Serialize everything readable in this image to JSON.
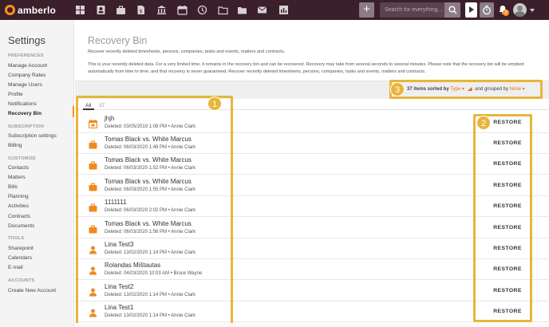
{
  "app": {
    "name": "amberlo",
    "accent": "#f7931e",
    "callout_color": "#e8b53a"
  },
  "topbar": {
    "nav_icons": [
      "dashboard-icon",
      "contacts-icon",
      "matters-icon",
      "bills-icon",
      "bank-icon",
      "calendar-icon",
      "history-icon",
      "folder-icon",
      "documents-icon",
      "mail-icon",
      "reports-icon"
    ],
    "add_label": "+",
    "search_placeholder": "Search for everything...",
    "notification_count": "2"
  },
  "sidebar": {
    "title": "Settings",
    "sections": [
      {
        "label": "PREFERENCES",
        "items": [
          "Manage Account",
          "Company Rates",
          "Manage Users",
          "Profile",
          "Notifications",
          "Recovery Bin"
        ]
      },
      {
        "label": "SUBSCRIPTION",
        "items": [
          "Subscription settings",
          "Billing"
        ]
      },
      {
        "label": "CUSTOMIZE",
        "items": [
          "Contacts",
          "Matters",
          "Bills",
          "Planning",
          "Activities",
          "Contracts",
          "Documents"
        ]
      },
      {
        "label": "TOOLS",
        "items": [
          "Sharepoint",
          "Calendars",
          "E-mail"
        ]
      },
      {
        "label": "ACCOUNTS",
        "items": [
          "Create New Account"
        ]
      }
    ],
    "active_item": "Recovery Bin"
  },
  "header": {
    "title": "Recovery Bin",
    "subtitle": "Recover recently deleted timesheets, persons, companies, tasks and events, matters and contracts.",
    "description": "This is your recently deleted data. For a very limited time, it remains in the recovery bin and can be recovered. Recovery may take from several seconds to several minutes. Please note that the recovery bin will be emptied automatically from time to time, and that recovery is never guaranteed. Recover recently deleted timesheets, persons, companies, tasks and events, matters and contracts."
  },
  "sort": {
    "count_text": "37 items sorted by",
    "sort_field": "Type",
    "group_text": "and grouped by",
    "group_field": "None"
  },
  "tabs": {
    "all_label": "All",
    "all_count": "37"
  },
  "restore_label": "RESTORE",
  "items": [
    {
      "type": "event",
      "icon": "calendar-event-icon",
      "title": "jhjh",
      "meta": "Deleted: 03/05/2019 1:08 PM • Annie Clark"
    },
    {
      "type": "matter",
      "icon": "briefcase-icon",
      "title": "Tomas Black vs. White Marcus",
      "meta": "Deleted: 06/03/2020 1:49 PM • Annie Clark"
    },
    {
      "type": "matter",
      "icon": "briefcase-icon",
      "title": "Tomas Black vs. White Marcus",
      "meta": "Deleted: 06/03/2020 1:52 PM • Annie Clark"
    },
    {
      "type": "matter",
      "icon": "briefcase-icon",
      "title": "Tomas Black vs. White Marcus",
      "meta": "Deleted: 06/03/2020 1:55 PM • Annie Clark"
    },
    {
      "type": "matter",
      "icon": "briefcase-icon",
      "title": "1111111",
      "meta": "Deleted: 06/03/2020 2:02 PM • Annie Clark"
    },
    {
      "type": "matter",
      "icon": "briefcase-icon",
      "title": "Tomas Black vs. White Marcus",
      "meta": "Deleted: 06/03/2020 1:56 PM • Annie Clark"
    },
    {
      "type": "person",
      "icon": "person-icon",
      "title": "Lina Test3",
      "meta": "Deleted: 13/02/2020 1:14 PM • Annie Clark"
    },
    {
      "type": "person",
      "icon": "person-icon",
      "title": "Rolandas Mištautas",
      "meta": "Deleted: 04/03/2020 10:03 AM • Bruce Wayne"
    },
    {
      "type": "person",
      "icon": "person-icon",
      "title": "Lina Test2",
      "meta": "Deleted: 13/02/2020 1:14 PM • Annie Clark"
    },
    {
      "type": "person",
      "icon": "person-icon",
      "title": "Lina Test1",
      "meta": "Deleted: 13/02/2020 1:14 PM • Annie Clark"
    }
  ],
  "callouts": [
    "1",
    "2",
    "3"
  ]
}
